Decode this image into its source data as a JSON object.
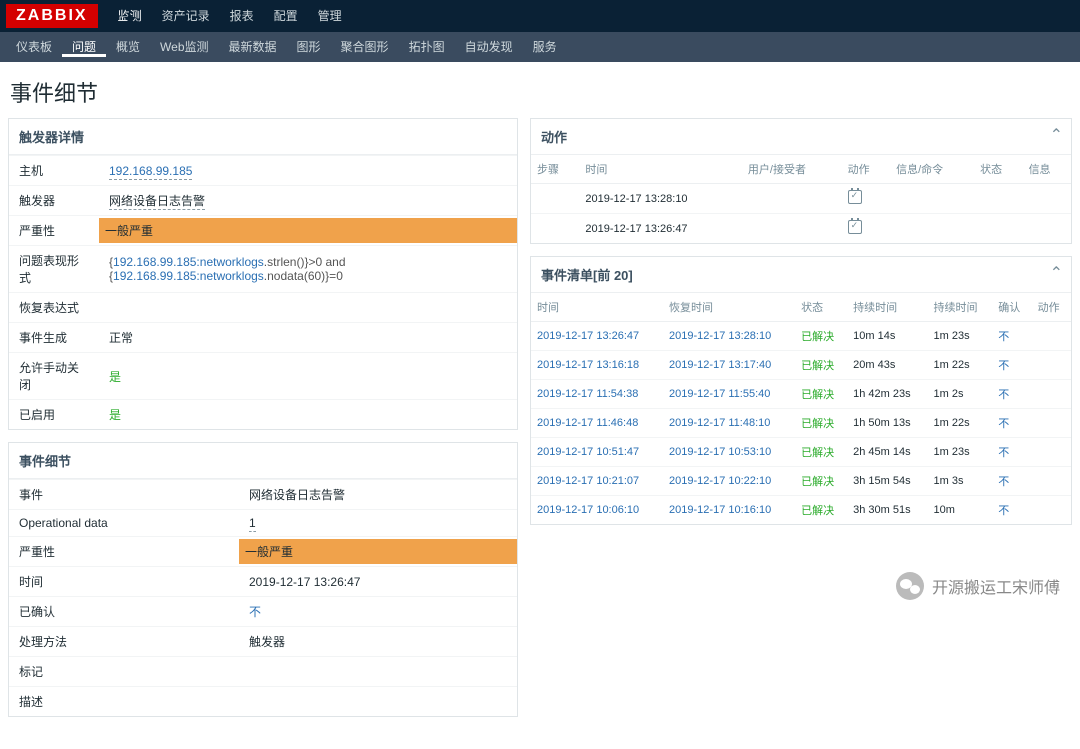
{
  "logo": "ZABBIX",
  "topnav": [
    "监测",
    "资产记录",
    "报表",
    "配置",
    "管理"
  ],
  "topnav_active": 0,
  "subnav": [
    "仪表板",
    "问题",
    "概览",
    "Web监测",
    "最新数据",
    "图形",
    "聚合图形",
    "拓扑图",
    "自动发现",
    "服务"
  ],
  "subnav_active": 1,
  "page_title": "事件细节",
  "trigger": {
    "heading": "触发器详情",
    "host_label": "主机",
    "host": "192.168.99.185",
    "trigger_label": "触发器",
    "trigger": "网络设备日志告警",
    "severity_label": "严重性",
    "severity": "一般严重",
    "expr_label": "问题表现形式",
    "expr_pre": "{",
    "expr_link1": "192.168.99.185:networklogs",
    "expr_mid1": ".strlen()}>0 and {",
    "expr_link2": "192.168.99.185:networklogs",
    "expr_mid2": ".nodata(60)}=0",
    "recovery_label": "恢复表达式",
    "gen_label": "事件生成",
    "gen": "正常",
    "manual_label": "允许手动关闭",
    "manual": "是",
    "enabled_label": "已启用",
    "enabled": "是"
  },
  "detail": {
    "heading": "事件细节",
    "event_label": "事件",
    "event": "网络设备日志告警",
    "op_label": "Operational data",
    "op": "1",
    "sev_label": "严重性",
    "sev": "一般严重",
    "time_label": "时间",
    "time": "2019-12-17 13:26:47",
    "ack_label": "已确认",
    "ack": "不",
    "proc_label": "处理方法",
    "proc": "触发器",
    "tag_label": "标记",
    "desc_label": "描述"
  },
  "actions": {
    "heading": "动作",
    "cols": [
      "步骤",
      "时间",
      "用户/接受者",
      "动作",
      "信息/命令",
      "状态",
      "信息"
    ],
    "rows": [
      [
        "",
        "2019-12-17 13:28:10",
        "",
        "cal",
        "",
        "",
        ""
      ],
      [
        "",
        "2019-12-17 13:26:47",
        "",
        "cal",
        "",
        "",
        ""
      ]
    ]
  },
  "events": {
    "heading": "事件清单[前 20]",
    "cols": [
      "时间",
      "恢复时间",
      "状态",
      "持续时间",
      "持续时间",
      "确认",
      "动作"
    ],
    "rows": [
      {
        "t": "2019-12-17 13:26:47",
        "r": "2019-12-17 13:28:10",
        "s": "已解决",
        "d": "10m 14s",
        "d2": "1m 23s",
        "a": "不"
      },
      {
        "t": "2019-12-17 13:16:18",
        "r": "2019-12-17 13:17:40",
        "s": "已解决",
        "d": "20m 43s",
        "d2": "1m 22s",
        "a": "不"
      },
      {
        "t": "2019-12-17 11:54:38",
        "r": "2019-12-17 11:55:40",
        "s": "已解决",
        "d": "1h 42m 23s",
        "d2": "1m 2s",
        "a": "不"
      },
      {
        "t": "2019-12-17 11:46:48",
        "r": "2019-12-17 11:48:10",
        "s": "已解决",
        "d": "1h 50m 13s",
        "d2": "1m 22s",
        "a": "不"
      },
      {
        "t": "2019-12-17 10:51:47",
        "r": "2019-12-17 10:53:10",
        "s": "已解决",
        "d": "2h 45m 14s",
        "d2": "1m 23s",
        "a": "不"
      },
      {
        "t": "2019-12-17 10:21:07",
        "r": "2019-12-17 10:22:10",
        "s": "已解决",
        "d": "3h 15m 54s",
        "d2": "1m 3s",
        "a": "不"
      },
      {
        "t": "2019-12-17 10:06:10",
        "r": "2019-12-17 10:16:10",
        "s": "已解决",
        "d": "3h 30m 51s",
        "d2": "10m",
        "a": "不"
      }
    ]
  },
  "watermark": "开源搬运工宋师傅"
}
